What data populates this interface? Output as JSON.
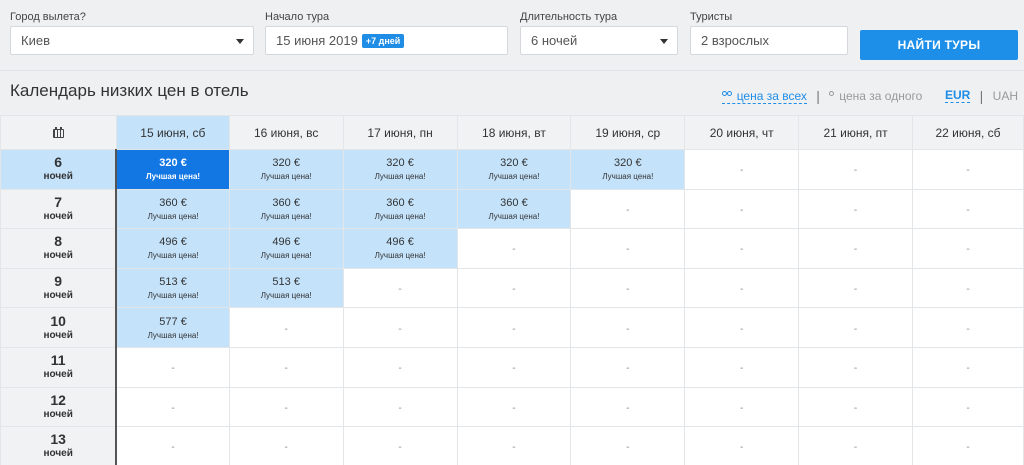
{
  "search": {
    "departure": {
      "label": "Город вылета?",
      "value": "Киев"
    },
    "start": {
      "label": "Начало тура",
      "value": "15 июня 2019",
      "badge": "+7 дней"
    },
    "duration": {
      "label": "Длительность тура",
      "value": "6 ночей"
    },
    "tourists": {
      "label": "Туристы",
      "value": "2 взрослых"
    },
    "button": "НАЙТИ ТУРЫ"
  },
  "title": "Календарь низких цен в отель",
  "price_toggle": {
    "per_all": "цена за всех",
    "per_one": "цена за одного",
    "separator": "|"
  },
  "currency": {
    "eur": "EUR",
    "uah": "UAH",
    "separator": "|"
  },
  "colors": {
    "accent": "#1e8fe8",
    "selected_cell": "#1377e3",
    "highlight": "#c4e3fb"
  },
  "table": {
    "corner_icon": "calendar-icon",
    "dates": [
      "15 июня, сб",
      "16 июня, вс",
      "17 июня, пн",
      "18 июня, вт",
      "19 июня, ср",
      "20 июня, чт",
      "21 июня, пт",
      "22 июня, сб"
    ],
    "rows": [
      {
        "nights": "6",
        "unit": "ночей",
        "cells": [
          {
            "price": "320 €",
            "note": "Лучшая цена!"
          },
          {
            "price": "320 €",
            "note": "Лучшая цена!"
          },
          {
            "price": "320 €",
            "note": "Лучшая цена!"
          },
          {
            "price": "320 €",
            "note": "Лучшая цена!"
          },
          {
            "price": "320 €",
            "note": "Лучшая цена!"
          },
          {
            "empty": "-"
          },
          {
            "empty": "-"
          },
          {
            "empty": "-"
          }
        ]
      },
      {
        "nights": "7",
        "unit": "ночей",
        "cells": [
          {
            "price": "360 €",
            "note": "Лучшая цена!"
          },
          {
            "price": "360 €",
            "note": "Лучшая цена!"
          },
          {
            "price": "360 €",
            "note": "Лучшая цена!"
          },
          {
            "price": "360 €",
            "note": "Лучшая цена!"
          },
          {
            "empty": "-"
          },
          {
            "empty": "-"
          },
          {
            "empty": "-"
          },
          {
            "empty": "-"
          }
        ]
      },
      {
        "nights": "8",
        "unit": "ночей",
        "cells": [
          {
            "price": "496 €",
            "note": "Лучшая цена!"
          },
          {
            "price": "496 €",
            "note": "Лучшая цена!"
          },
          {
            "price": "496 €",
            "note": "Лучшая цена!"
          },
          {
            "empty": "-"
          },
          {
            "empty": "-"
          },
          {
            "empty": "-"
          },
          {
            "empty": "-"
          },
          {
            "empty": "-"
          }
        ]
      },
      {
        "nights": "9",
        "unit": "ночей",
        "cells": [
          {
            "price": "513 €",
            "note": "Лучшая цена!"
          },
          {
            "price": "513 €",
            "note": "Лучшая цена!"
          },
          {
            "empty": "-"
          },
          {
            "empty": "-"
          },
          {
            "empty": "-"
          },
          {
            "empty": "-"
          },
          {
            "empty": "-"
          },
          {
            "empty": "-"
          }
        ]
      },
      {
        "nights": "10",
        "unit": "ночей",
        "cells": [
          {
            "price": "577 €",
            "note": "Лучшая цена!"
          },
          {
            "empty": "-"
          },
          {
            "empty": "-"
          },
          {
            "empty": "-"
          },
          {
            "empty": "-"
          },
          {
            "empty": "-"
          },
          {
            "empty": "-"
          },
          {
            "empty": "-"
          }
        ]
      },
      {
        "nights": "11",
        "unit": "ночей",
        "cells": [
          {
            "empty": "-"
          },
          {
            "empty": "-"
          },
          {
            "empty": "-"
          },
          {
            "empty": "-"
          },
          {
            "empty": "-"
          },
          {
            "empty": "-"
          },
          {
            "empty": "-"
          },
          {
            "empty": "-"
          }
        ]
      },
      {
        "nights": "12",
        "unit": "ночей",
        "cells": [
          {
            "empty": "-"
          },
          {
            "empty": "-"
          },
          {
            "empty": "-"
          },
          {
            "empty": "-"
          },
          {
            "empty": "-"
          },
          {
            "empty": "-"
          },
          {
            "empty": "-"
          },
          {
            "empty": "-"
          }
        ]
      },
      {
        "nights": "13",
        "unit": "ночей",
        "cells": [
          {
            "empty": "-"
          },
          {
            "empty": "-"
          },
          {
            "empty": "-"
          },
          {
            "empty": "-"
          },
          {
            "empty": "-"
          },
          {
            "empty": "-"
          },
          {
            "empty": "-"
          },
          {
            "empty": "-"
          }
        ]
      }
    ]
  }
}
